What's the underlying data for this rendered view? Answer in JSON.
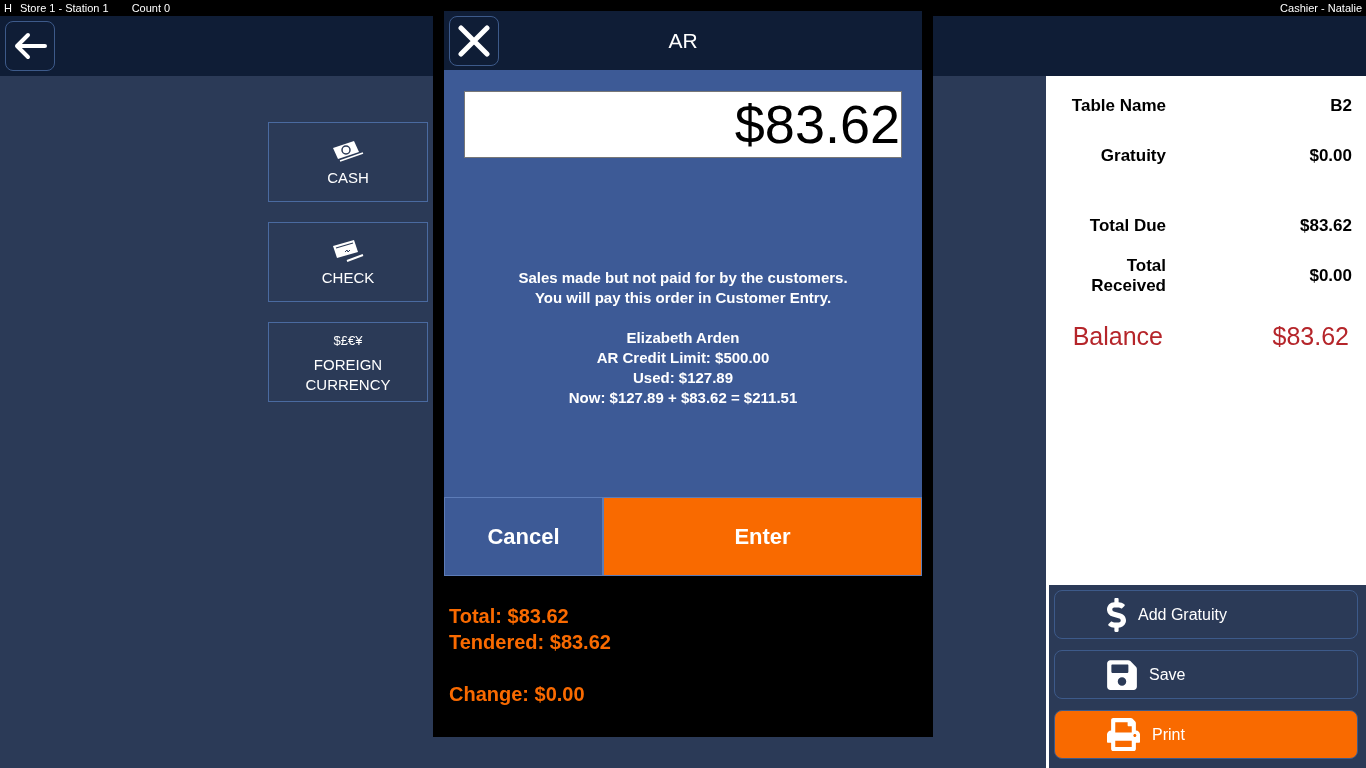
{
  "status_bar": {
    "mode": "H",
    "station": "Store 1 - Station 1",
    "count": "Count 0",
    "user": "Cashier - Natalie"
  },
  "payment_methods": [
    {
      "kind": "cash",
      "label": "CASH"
    },
    {
      "kind": "check",
      "label": "CHECK"
    },
    {
      "kind": "foreign",
      "symbols": "$£€¥",
      "label": "FOREIGN CURRENCY"
    }
  ],
  "order_summary": {
    "details": [
      {
        "label": "Table Name",
        "value": "B2"
      },
      {
        "label": "Gratuity",
        "value": "$0.00"
      }
    ],
    "totals": [
      {
        "label": "Total Due",
        "value": "$83.62"
      },
      {
        "label": "Total Received",
        "value": "$0.00"
      }
    ],
    "balance": {
      "label": "Balance",
      "value": "$83.62"
    }
  },
  "actions": [
    {
      "kind": "gratuity",
      "label": "Add Gratuity",
      "primary": false
    },
    {
      "kind": "save",
      "label": "Save",
      "primary": false
    },
    {
      "kind": "print",
      "label": "Print",
      "primary": true
    }
  ],
  "dialog": {
    "title": "AR",
    "amount": "$83.62",
    "note": [
      "Sales made but not paid for by the customers.",
      "You will pay this order in Customer Entry."
    ],
    "customer_lines": [
      "Elizabeth Arden",
      "AR Credit Limit: $500.00",
      "Used: $127.89",
      "Now: $127.89 + $83.62 = $211.51"
    ],
    "buttons": [
      {
        "kind": "cancel",
        "label": "Cancel"
      },
      {
        "kind": "enter",
        "label": "Enter"
      }
    ],
    "tender_lines": [
      "Total: $83.62",
      "Tendered: $83.62"
    ],
    "change": "Change: $0.00"
  }
}
